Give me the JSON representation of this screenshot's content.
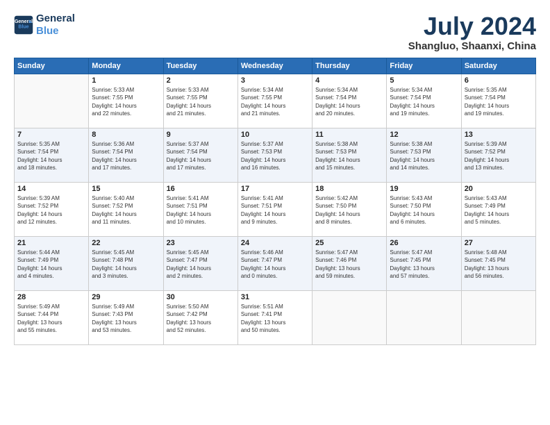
{
  "logo": {
    "line1": "General",
    "line2": "Blue"
  },
  "title": "July 2024",
  "subtitle": "Shangluo, Shaanxi, China",
  "headers": [
    "Sunday",
    "Monday",
    "Tuesday",
    "Wednesday",
    "Thursday",
    "Friday",
    "Saturday"
  ],
  "weeks": [
    [
      {
        "day": "",
        "info": ""
      },
      {
        "day": "1",
        "info": "Sunrise: 5:33 AM\nSunset: 7:55 PM\nDaylight: 14 hours\nand 22 minutes."
      },
      {
        "day": "2",
        "info": "Sunrise: 5:33 AM\nSunset: 7:55 PM\nDaylight: 14 hours\nand 21 minutes."
      },
      {
        "day": "3",
        "info": "Sunrise: 5:34 AM\nSunset: 7:55 PM\nDaylight: 14 hours\nand 21 minutes."
      },
      {
        "day": "4",
        "info": "Sunrise: 5:34 AM\nSunset: 7:54 PM\nDaylight: 14 hours\nand 20 minutes."
      },
      {
        "day": "5",
        "info": "Sunrise: 5:34 AM\nSunset: 7:54 PM\nDaylight: 14 hours\nand 19 minutes."
      },
      {
        "day": "6",
        "info": "Sunrise: 5:35 AM\nSunset: 7:54 PM\nDaylight: 14 hours\nand 19 minutes."
      }
    ],
    [
      {
        "day": "7",
        "info": "Sunrise: 5:35 AM\nSunset: 7:54 PM\nDaylight: 14 hours\nand 18 minutes."
      },
      {
        "day": "8",
        "info": "Sunrise: 5:36 AM\nSunset: 7:54 PM\nDaylight: 14 hours\nand 17 minutes."
      },
      {
        "day": "9",
        "info": "Sunrise: 5:37 AM\nSunset: 7:54 PM\nDaylight: 14 hours\nand 17 minutes."
      },
      {
        "day": "10",
        "info": "Sunrise: 5:37 AM\nSunset: 7:53 PM\nDaylight: 14 hours\nand 16 minutes."
      },
      {
        "day": "11",
        "info": "Sunrise: 5:38 AM\nSunset: 7:53 PM\nDaylight: 14 hours\nand 15 minutes."
      },
      {
        "day": "12",
        "info": "Sunrise: 5:38 AM\nSunset: 7:53 PM\nDaylight: 14 hours\nand 14 minutes."
      },
      {
        "day": "13",
        "info": "Sunrise: 5:39 AM\nSunset: 7:52 PM\nDaylight: 14 hours\nand 13 minutes."
      }
    ],
    [
      {
        "day": "14",
        "info": "Sunrise: 5:39 AM\nSunset: 7:52 PM\nDaylight: 14 hours\nand 12 minutes."
      },
      {
        "day": "15",
        "info": "Sunrise: 5:40 AM\nSunset: 7:52 PM\nDaylight: 14 hours\nand 11 minutes."
      },
      {
        "day": "16",
        "info": "Sunrise: 5:41 AM\nSunset: 7:51 PM\nDaylight: 14 hours\nand 10 minutes."
      },
      {
        "day": "17",
        "info": "Sunrise: 5:41 AM\nSunset: 7:51 PM\nDaylight: 14 hours\nand 9 minutes."
      },
      {
        "day": "18",
        "info": "Sunrise: 5:42 AM\nSunset: 7:50 PM\nDaylight: 14 hours\nand 8 minutes."
      },
      {
        "day": "19",
        "info": "Sunrise: 5:43 AM\nSunset: 7:50 PM\nDaylight: 14 hours\nand 6 minutes."
      },
      {
        "day": "20",
        "info": "Sunrise: 5:43 AM\nSunset: 7:49 PM\nDaylight: 14 hours\nand 5 minutes."
      }
    ],
    [
      {
        "day": "21",
        "info": "Sunrise: 5:44 AM\nSunset: 7:49 PM\nDaylight: 14 hours\nand 4 minutes."
      },
      {
        "day": "22",
        "info": "Sunrise: 5:45 AM\nSunset: 7:48 PM\nDaylight: 14 hours\nand 3 minutes."
      },
      {
        "day": "23",
        "info": "Sunrise: 5:45 AM\nSunset: 7:47 PM\nDaylight: 14 hours\nand 2 minutes."
      },
      {
        "day": "24",
        "info": "Sunrise: 5:46 AM\nSunset: 7:47 PM\nDaylight: 14 hours\nand 0 minutes."
      },
      {
        "day": "25",
        "info": "Sunrise: 5:47 AM\nSunset: 7:46 PM\nDaylight: 13 hours\nand 59 minutes."
      },
      {
        "day": "26",
        "info": "Sunrise: 5:47 AM\nSunset: 7:45 PM\nDaylight: 13 hours\nand 57 minutes."
      },
      {
        "day": "27",
        "info": "Sunrise: 5:48 AM\nSunset: 7:45 PM\nDaylight: 13 hours\nand 56 minutes."
      }
    ],
    [
      {
        "day": "28",
        "info": "Sunrise: 5:49 AM\nSunset: 7:44 PM\nDaylight: 13 hours\nand 55 minutes."
      },
      {
        "day": "29",
        "info": "Sunrise: 5:49 AM\nSunset: 7:43 PM\nDaylight: 13 hours\nand 53 minutes."
      },
      {
        "day": "30",
        "info": "Sunrise: 5:50 AM\nSunset: 7:42 PM\nDaylight: 13 hours\nand 52 minutes."
      },
      {
        "day": "31",
        "info": "Sunrise: 5:51 AM\nSunset: 7:41 PM\nDaylight: 13 hours\nand 50 minutes."
      },
      {
        "day": "",
        "info": ""
      },
      {
        "day": "",
        "info": ""
      },
      {
        "day": "",
        "info": ""
      }
    ]
  ]
}
